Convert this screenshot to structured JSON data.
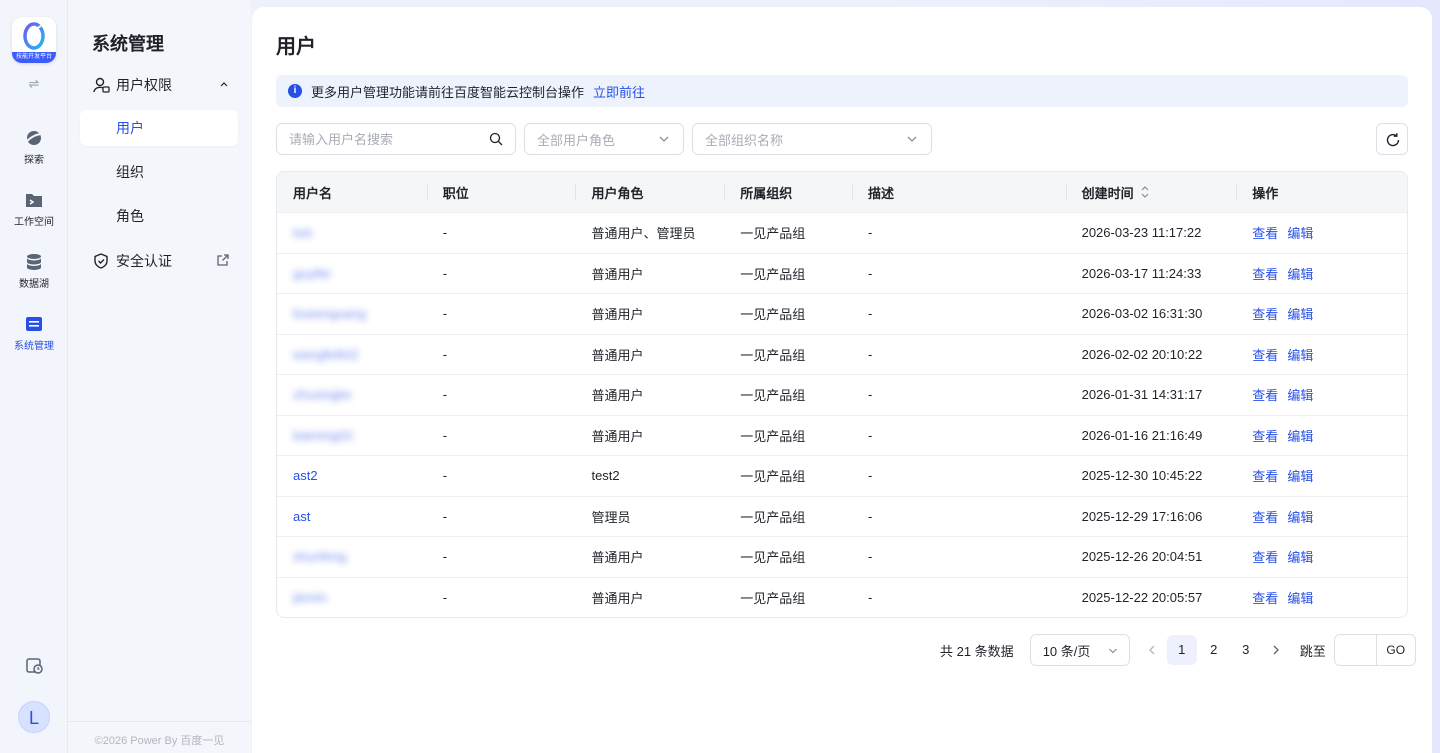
{
  "app": {
    "logo_text": "技能开发平台",
    "rail": [
      {
        "label": "探索",
        "icon": "planet-icon"
      },
      {
        "label": "工作空间",
        "icon": "folder-terminal-icon"
      },
      {
        "label": "数据湖",
        "icon": "database-icon"
      },
      {
        "label": "系统管理",
        "icon": "system-manage-icon",
        "active": true
      }
    ],
    "avatar_letter": "L"
  },
  "sidebar": {
    "title": "系统管理",
    "group_label": "用户权限",
    "sub_items": [
      "用户",
      "组织",
      "角色"
    ],
    "security_label": "安全认证",
    "footer": "©2026 Power By 百度一见"
  },
  "main": {
    "title": "用户",
    "notice": {
      "text": "更多用户管理功能请前往百度智能云控制台操作",
      "link": "立即前往"
    },
    "filters": {
      "search_placeholder": "请输入用户名搜索",
      "role_placeholder": "全部用户角色",
      "org_placeholder": "全部组织名称"
    },
    "table": {
      "columns": [
        "用户名",
        "职位",
        "用户角色",
        "所属组织",
        "描述",
        "创建时间",
        "操作"
      ],
      "rows": [
        {
          "username": "luis",
          "position": "-",
          "role": "普通用户、管理员",
          "org": "一见产品组",
          "desc": "-",
          "created": "2026-03-23 11:17:22"
        },
        {
          "username": "guyifei",
          "position": "-",
          "role": "普通用户",
          "org": "一见产品组",
          "desc": "-",
          "created": "2026-03-17 11:24:33"
        },
        {
          "username": "liuwenguang",
          "position": "-",
          "role": "普通用户",
          "org": "一见产品组",
          "desc": "-",
          "created": "2026-03-02 16:31:30"
        },
        {
          "username": "wangfeifei2",
          "position": "-",
          "role": "普通用户",
          "org": "一见产品组",
          "desc": "-",
          "created": "2026-02-02 20:10:22"
        },
        {
          "username": "zhuxingke",
          "position": "-",
          "role": "普通用户",
          "org": "一见产品组",
          "desc": "-",
          "created": "2026-01-31 14:31:17"
        },
        {
          "username": "baiming02",
          "position": "-",
          "role": "普通用户",
          "org": "一见产品组",
          "desc": "-",
          "created": "2026-01-16 21:16:49"
        },
        {
          "username": "ast2",
          "position": "-",
          "role": "test2",
          "org": "一见产品组",
          "desc": "-",
          "created": "2025-12-30 10:45:22"
        },
        {
          "username": "ast",
          "position": "-",
          "role": "管理员",
          "org": "一见产品组",
          "desc": "-",
          "created": "2025-12-29 17:16:06"
        },
        {
          "username": "shunfeng",
          "position": "-",
          "role": "普通用户",
          "org": "一见产品组",
          "desc": "-",
          "created": "2025-12-26 20:04:51"
        },
        {
          "username": "jiemin",
          "position": "-",
          "role": "普通用户",
          "org": "一见产品组",
          "desc": "-",
          "created": "2025-12-22 20:05:57"
        }
      ],
      "view_label": "查看",
      "edit_label": "编辑"
    },
    "pagination": {
      "total_text": "共 21 条数据",
      "page_size": "10 条/页",
      "pages": [
        "1",
        "2",
        "3"
      ],
      "current_page": "1",
      "jump_label": "跳至",
      "go_label": "GO"
    }
  }
}
